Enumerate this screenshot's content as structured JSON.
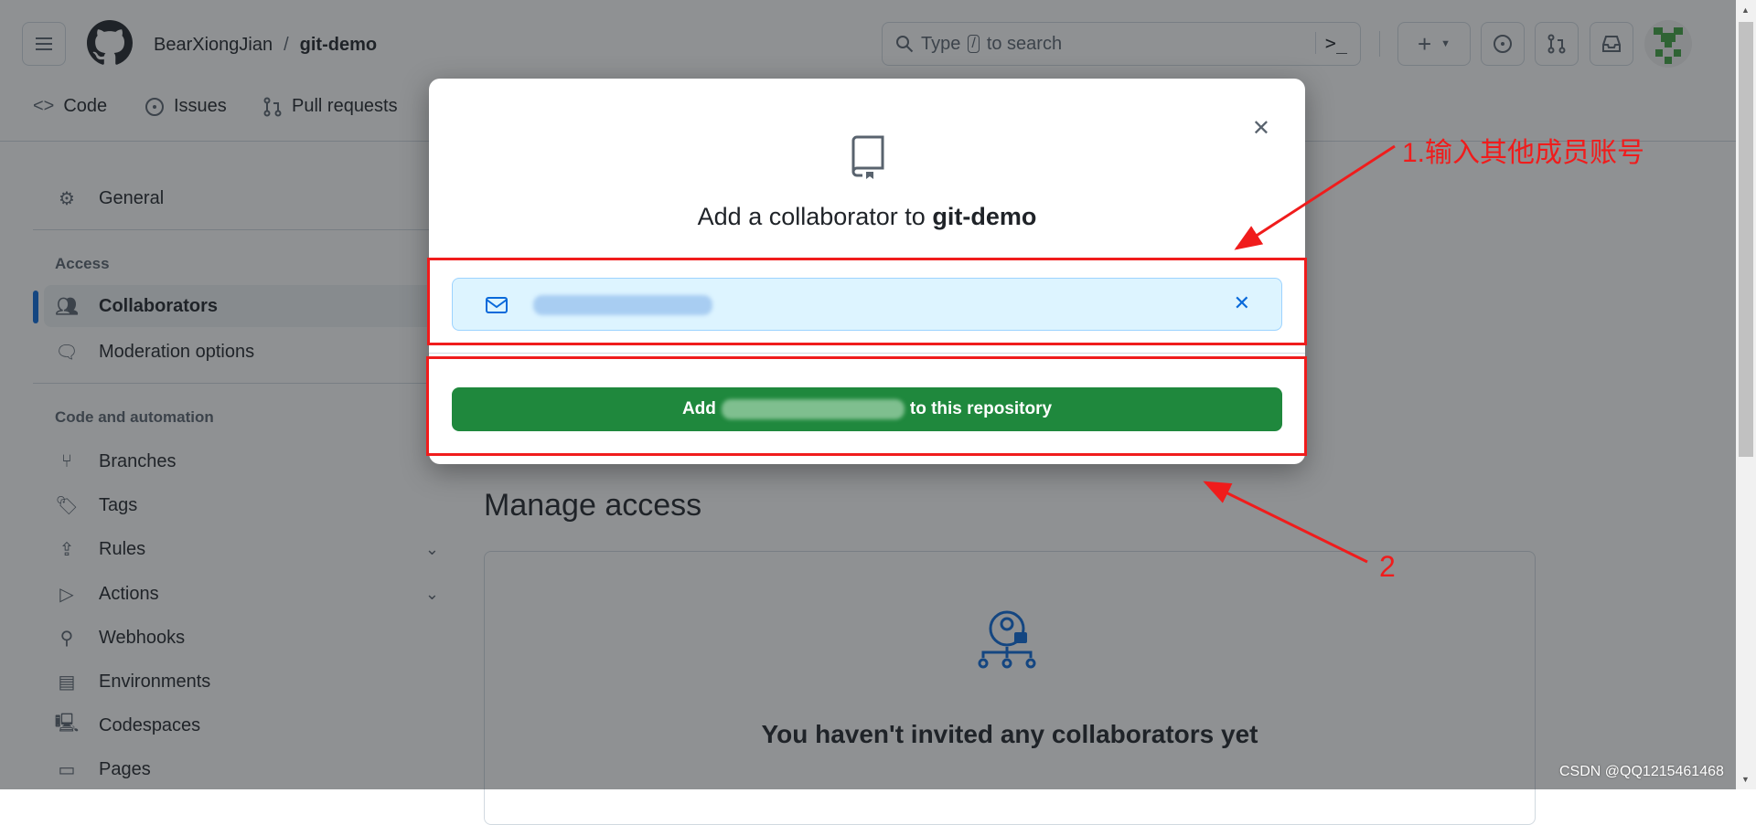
{
  "header": {
    "owner": "BearXiongJian",
    "separator": "/",
    "repo": "git-demo",
    "search_placeholder_prefix": "Type",
    "search_key": "/",
    "search_placeholder_suffix": "to search"
  },
  "repo_tabs": [
    {
      "label": "Code"
    },
    {
      "label": "Issues"
    },
    {
      "label": "Pull requests"
    }
  ],
  "sidebar": {
    "general": "General",
    "access_heading": "Access",
    "access_items": [
      {
        "label": "Collaborators",
        "active": true
      },
      {
        "label": "Moderation options"
      }
    ],
    "code_heading": "Code and automation",
    "code_items": [
      {
        "label": "Branches"
      },
      {
        "label": "Tags"
      },
      {
        "label": "Rules"
      },
      {
        "label": "Actions"
      },
      {
        "label": "Webhooks"
      },
      {
        "label": "Environments"
      },
      {
        "label": "Codespaces"
      },
      {
        "label": "Pages"
      }
    ]
  },
  "main": {
    "title": "Manage access",
    "empty_title": "You haven't invited any collaborators yet"
  },
  "modal": {
    "title_prefix": "Add a collaborator to",
    "title_repo": "git-demo",
    "add_prefix": "Add",
    "add_suffix": "to this repository"
  },
  "annotations": {
    "step1": "1.输入其他成员账号",
    "step2": "2"
  },
  "watermark": "CSDN @QQ1215461468",
  "colors": {
    "accent": "#0969da",
    "primary_button": "#1f883d",
    "annotation": "#f01c1c",
    "chip_bg": "#ddf4ff"
  }
}
